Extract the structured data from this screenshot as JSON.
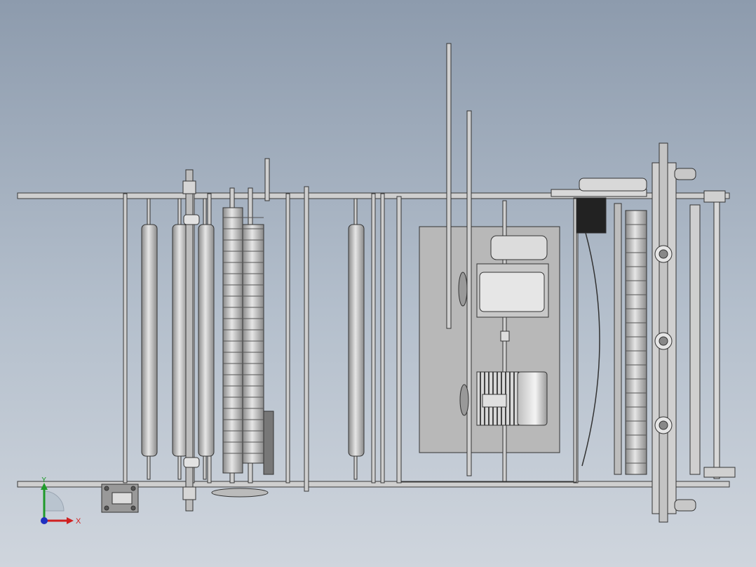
{
  "viewport": {
    "background_top": "#8d9bad",
    "background_bottom": "#cfd5dd",
    "part_color": "#c4c4c4",
    "edge_color": "#3a3a3a"
  },
  "triad": {
    "x_label": "X",
    "y_label": "Y",
    "x_color": "#d02020",
    "y_color": "#1f9a2a",
    "z_color": "#2030c0"
  }
}
